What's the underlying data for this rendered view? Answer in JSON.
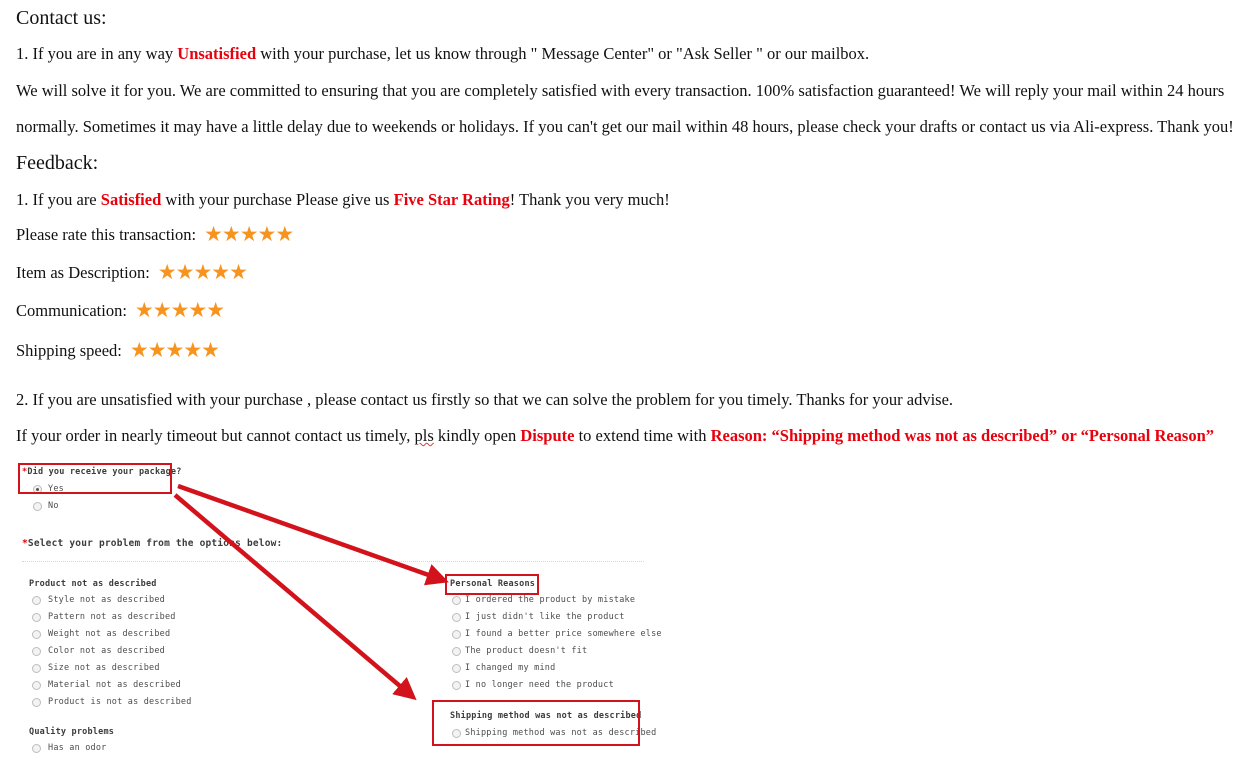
{
  "document": {
    "contact_heading": "Contact us:",
    "contact_line1_pre": "1.  If you are in any way ",
    "contact_line1_red": "Unsatisfied",
    "contact_line1_post": " with your purchase, let us know through \" Message Center\" or \"Ask Seller \" or our mailbox.",
    "contact_line2": "We will solve it for you. We are committed to ensuring that you are completely satisfied with every transaction. 100% satisfaction guaranteed!    We will reply your mail within 24 hours",
    "contact_line3": "normally. Sometimes it may have a little delay due to weekends or holidays. If you can't get our mail within 48 hours, please check your drafts or contact us via Ali-express. Thank you!",
    "feedback_heading": "Feedback:",
    "feedback_line1_pre": "1.  If you are ",
    "feedback_line1_red1": "Satisfied",
    "feedback_line1_mid": " with your purchase Please give us ",
    "feedback_line1_red2": "Five Star Rating",
    "feedback_line1_post": "! Thank you very much!",
    "closing_line1": "2.  If you are unsatisfied with your purchase , please contact us firstly so that we can solve the problem  for you timely. Thanks for your advise.",
    "closing_line2_pre": "If your order in nearly timeout but cannot contact us timely, ",
    "closing_line2_squiggle": "pls",
    "closing_line2_mid": " kindly open ",
    "closing_line2_red1": "Dispute",
    "closing_line2_mid2": " to extend time with ",
    "closing_line2_red2": "Reason: “Shipping method was not as described” or “Personal Reason”"
  },
  "ratings": {
    "star_glyph": "★★★★★",
    "star_color": "#f79420",
    "rows": [
      {
        "label": "Please rate this transaction:",
        "stars": 5
      },
      {
        "label": "Item as Description:",
        "stars": 5
      },
      {
        "label": "Communication:",
        "stars": 5
      },
      {
        "label": "Shipping speed:",
        "stars": 5
      }
    ]
  },
  "form": {
    "question_label": "*Did you receive your package?",
    "question_required_mark": "*",
    "question_text": "Did you receive your package?",
    "yes_label": "Yes",
    "no_label": "No",
    "select_problem_mark": "*",
    "select_problem_text": "Select your problem from the options below:",
    "groups": [
      {
        "title": "Product not as described",
        "options": [
          "Style not as described",
          "Pattern not as described",
          "Weight not as described",
          "Color not as described",
          "Size not as described",
          "Material not as described",
          "Product is not as described"
        ]
      },
      {
        "title": "Quality problems",
        "options": [
          "Has an odor"
        ]
      },
      {
        "title": "Personal Reasons",
        "options": [
          "I ordered the product by mistake",
          "I just didn't like the product",
          "I found a better price somewhere else",
          "The product doesn't fit",
          "I changed my mind",
          "I no longer need the product"
        ]
      },
      {
        "title": "Shipping method was not as described",
        "options": [
          "Shipping method was not as described"
        ]
      }
    ]
  },
  "annotations": {
    "highlight_color": "#d3131c",
    "boxes": [
      {
        "name": "did-you-receive-package"
      },
      {
        "name": "personal-reasons"
      },
      {
        "name": "shipping-method-not-as-described"
      }
    ],
    "arrows": [
      {
        "name": "arrow-to-personal-reasons"
      },
      {
        "name": "arrow-to-shipping-method"
      }
    ]
  }
}
